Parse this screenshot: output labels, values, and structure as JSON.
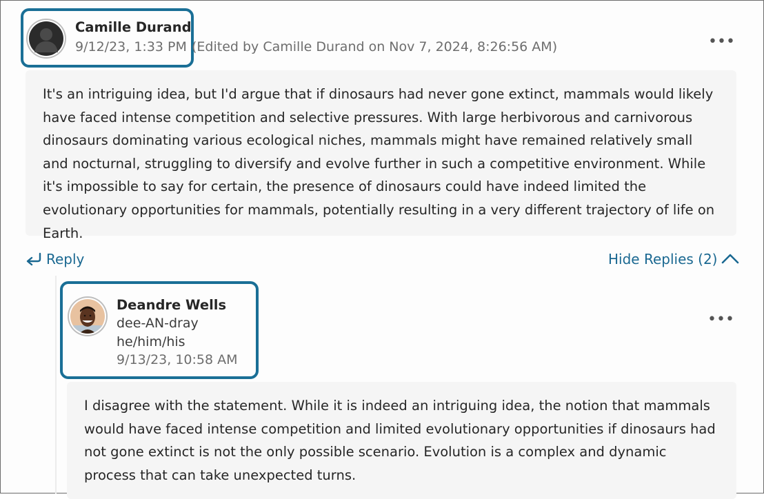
{
  "post": {
    "author": "Camille Durand",
    "date": "9/12/23, 1:33 PM",
    "edited_note": "(Edited by Camille Durand on Nov 7, 2024, 8:26:56 AM)",
    "more_label": "•••",
    "body": "It's an intriguing idea, but I'd argue that if dinosaurs had never gone extinct, mammals would likely have faced intense competition and selective pressures. With large herbivorous and carnivorous dinosaurs dominating various ecological niches, mammals might have remained relatively small and nocturnal, struggling to diversify and evolve further in such a competitive environment. While it's impossible to say for certain, the presence of dinosaurs could have indeed limited the evolutionary opportunities for mammals, potentially resulting in a very different trajectory of life on Earth."
  },
  "actions": {
    "reply_label": "Reply",
    "hide_replies_label": "Hide Replies (2)"
  },
  "reply": {
    "author": "Deandre Wells",
    "pronunciation": "dee-AN-dray",
    "pronouns": "he/him/his",
    "date": "9/13/23, 10:58 AM",
    "more_label": "•••",
    "body": "I disagree with the statement. While it is indeed an intriguing idea, the notion that mammals would have faced intense competition and limited evolutionary opportunities if dinosaurs had not gone extinct is not the only possible scenario. Evolution is a complex and dynamic process that can take unexpected turns."
  },
  "colors": {
    "highlight": "#1a6f96",
    "link": "#1a6891",
    "body_bg": "#f5f5f5"
  }
}
